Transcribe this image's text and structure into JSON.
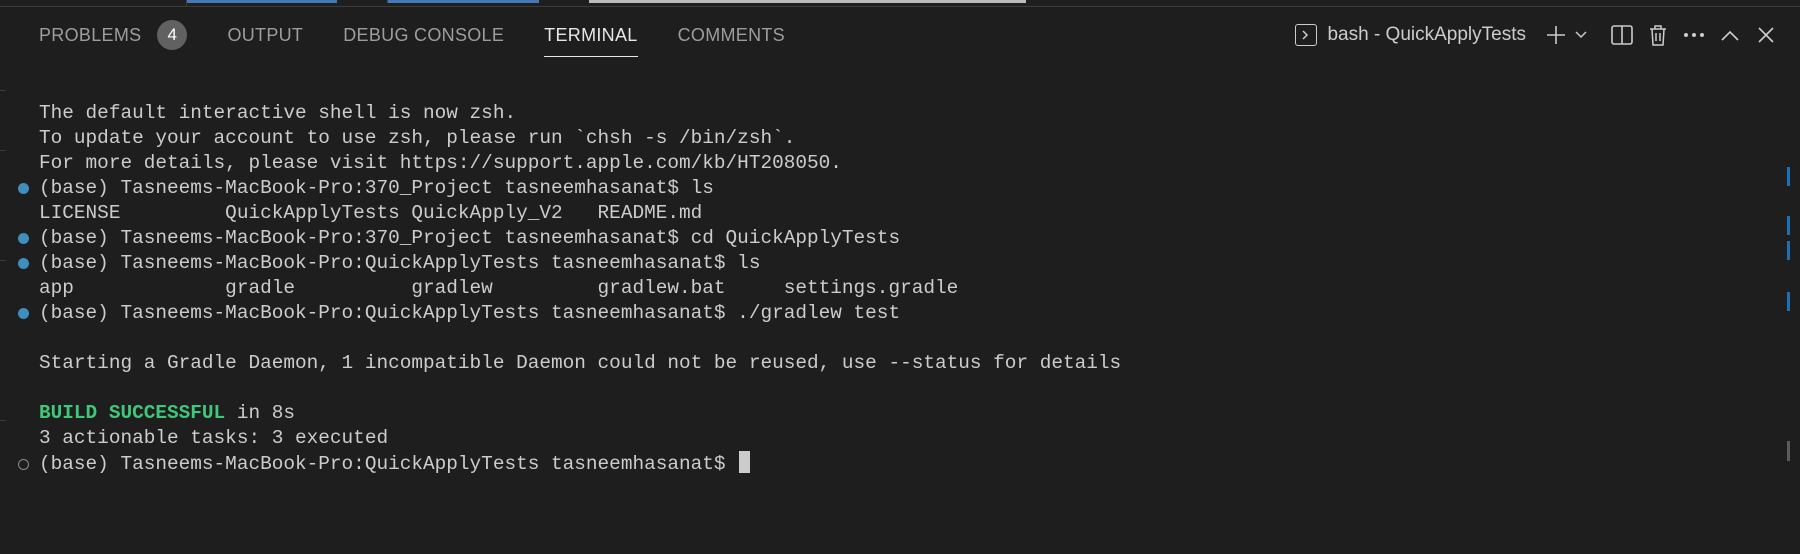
{
  "panel": {
    "tabs": [
      {
        "label": "PROBLEMS",
        "badge": "4"
      },
      {
        "label": "OUTPUT"
      },
      {
        "label": "DEBUG CONSOLE"
      },
      {
        "label": "TERMINAL",
        "active": true
      },
      {
        "label": "COMMENTS"
      }
    ],
    "terminal_name": "bash - QuickApplyTests",
    "icons": [
      "terminal-icon",
      "plus-icon",
      "chevron-down-icon",
      "split-icon",
      "trash-icon",
      "more-icon",
      "chevron-up-icon",
      "close-icon"
    ]
  },
  "terminal": {
    "lines": [
      {
        "text": "The default interactive shell is now zsh."
      },
      {
        "text": "To update your account to use zsh, please run `chsh -s /bin/zsh`."
      },
      {
        "text": "For more details, please visit https://support.apple.com/kb/HT208050."
      },
      {
        "text": "(base) Tasneems-MacBook-Pro:370_Project tasneemhasanat$ ls",
        "marker": "filled"
      },
      {
        "text": "LICENSE         QuickApplyTests QuickApply_V2   README.md"
      },
      {
        "text": "(base) Tasneems-MacBook-Pro:370_Project tasneemhasanat$ cd QuickApplyTests",
        "marker": "filled"
      },
      {
        "text": "(base) Tasneems-MacBook-Pro:QuickApplyTests tasneemhasanat$ ls",
        "marker": "filled"
      },
      {
        "text": "app             gradle          gradlew         gradlew.bat     settings.gradle"
      },
      {
        "text": "(base) Tasneems-MacBook-Pro:QuickApplyTests tasneemhasanat$ ./gradlew test",
        "marker": "filled"
      },
      {
        "text": ""
      },
      {
        "text": "Starting a Gradle Daemon, 1 incompatible Daemon could not be reused, use --status for details"
      },
      {
        "text": ""
      },
      {
        "highlight": "BUILD SUCCESSFUL",
        "text": " in 8s"
      },
      {
        "text": "3 actionable tasks: 3 executed"
      },
      {
        "text": "(base) Tasneems-MacBook-Pro:QuickApplyTests tasneemhasanat$ ",
        "marker": "hollow",
        "cursor": true
      }
    ]
  },
  "colors": {
    "background": "#1e1e1e",
    "text": "#cccccc",
    "success": "#3fc77a",
    "marker": "#3e8ec0"
  }
}
